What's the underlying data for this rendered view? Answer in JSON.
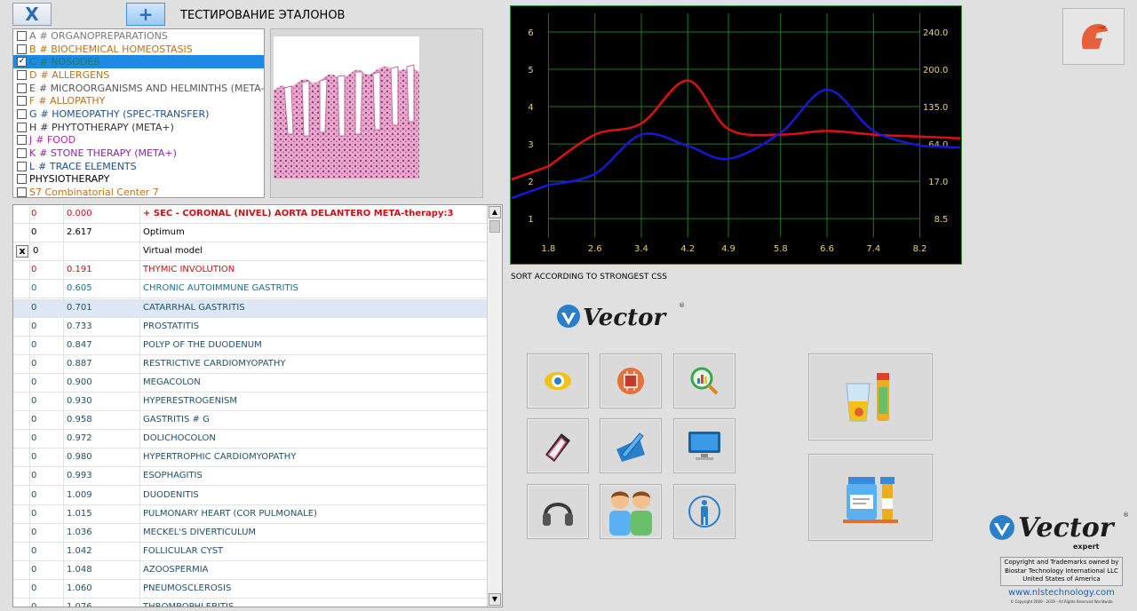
{
  "toolbar": {
    "close_label": "X",
    "add_label": "+",
    "title": "ТЕСТИРОВАНИЕ ЭТАЛОНОВ"
  },
  "categories": [
    {
      "letter": "A",
      "label": "# ORGANOPREPARATIONS",
      "color": "#7a7a7a",
      "checked": false,
      "selected": false
    },
    {
      "letter": "B",
      "label": "# BIOCHEMICAL HOMEOSTASIS",
      "color": "#c0701a",
      "checked": false,
      "selected": false
    },
    {
      "letter": "C",
      "label": "# NOSODES",
      "color": "#1b7f5a",
      "checked": true,
      "selected": true
    },
    {
      "letter": "D",
      "label": "# ALLERGENS",
      "color": "#c0701a",
      "checked": false,
      "selected": false
    },
    {
      "letter": "E",
      "label": "# MICROORGANISMS AND HELMINTHS (META-)",
      "color": "#555555",
      "checked": false,
      "selected": false
    },
    {
      "letter": "F",
      "label": "# ALLOPATHY",
      "color": "#c0701a",
      "checked": false,
      "selected": false
    },
    {
      "letter": "G",
      "label": "# HOMEOPATHY (SPEC-TRANSFER)",
      "color": "#1f4f8a",
      "checked": false,
      "selected": false
    },
    {
      "letter": "H",
      "label": "# PHYTOTHERAPY (META+)",
      "color": "#333333",
      "checked": false,
      "selected": false
    },
    {
      "letter": "J",
      "label": "# FOOD",
      "color": "#c020a8",
      "checked": false,
      "selected": false
    },
    {
      "letter": "K",
      "label": "# STONE THERAPY (META+)",
      "color": "#8a2aa0",
      "checked": false,
      "selected": false
    },
    {
      "letter": "L",
      "label": "# TRACE ELEMENTS",
      "color": "#1f4f8a",
      "checked": false,
      "selected": false
    },
    {
      "letter": "",
      "label": "PHYSIOTHERAPY",
      "color": "#000000",
      "checked": false,
      "selected": false
    },
    {
      "letter": "",
      "label": "S7 Combinatorial Center 7",
      "color": "#c0701a",
      "checked": false,
      "selected": false
    }
  ],
  "table": {
    "rows": [
      {
        "col1": "0",
        "col2": "0.000",
        "name": "+ SEC - CORONAL (NIVEL) AORTA DELANTERO META-therapy:3",
        "color": "#cc1111",
        "bold": true,
        "xbox": false,
        "highlight": false
      },
      {
        "col1": "0",
        "col2": "2.617",
        "name": "Optimum",
        "color": "#000000",
        "bold": false,
        "xbox": false,
        "highlight": false
      },
      {
        "col1": "0",
        "col2": "",
        "name": "Virtual model",
        "color": "#000000",
        "bold": false,
        "xbox": true,
        "xbox_label": "x",
        "highlight": false
      },
      {
        "col1": "0",
        "col2": "0.191",
        "name": "THYMIC INVOLUTION",
        "color": "#cc1111",
        "bold": false,
        "xbox": false,
        "highlight": false
      },
      {
        "col1": "0",
        "col2": "0.605",
        "name": "CHRONIC AUTOIMMUNE GASTRITIS",
        "color": "#1f6f8a",
        "bold": false,
        "xbox": false,
        "highlight": false
      },
      {
        "col1": "0",
        "col2": "0.701",
        "name": "CATARRHAL GASTRITIS",
        "color": "#1f4f6a",
        "bold": false,
        "xbox": false,
        "highlight": true
      },
      {
        "col1": "0",
        "col2": "0.733",
        "name": "PROSTATITIS",
        "color": "#1f4f6a",
        "bold": false,
        "xbox": false,
        "highlight": false
      },
      {
        "col1": "0",
        "col2": "0.847",
        "name": "POLYP OF THE DUODENUM",
        "color": "#1f4f6a",
        "bold": false,
        "xbox": false,
        "highlight": false
      },
      {
        "col1": "0",
        "col2": "0.887",
        "name": "RESTRICTIVE CARDIOMYOPATHY",
        "color": "#1f4f6a",
        "bold": false,
        "xbox": false,
        "highlight": false
      },
      {
        "col1": "0",
        "col2": "0.900",
        "name": "MEGACOLON",
        "color": "#1f4f6a",
        "bold": false,
        "xbox": false,
        "highlight": false
      },
      {
        "col1": "0",
        "col2": "0.930",
        "name": "HYPERESTROGENISM",
        "color": "#1f4f6a",
        "bold": false,
        "xbox": false,
        "highlight": false
      },
      {
        "col1": "0",
        "col2": "0.958",
        "name": "GASTRITIS # G",
        "color": "#1f4f6a",
        "bold": false,
        "xbox": false,
        "highlight": false
      },
      {
        "col1": "0",
        "col2": "0.972",
        "name": "DOLICHOCOLON",
        "color": "#1f4f6a",
        "bold": false,
        "xbox": false,
        "highlight": false
      },
      {
        "col1": "0",
        "col2": "0.980",
        "name": "HYPERTROPHIC CARDIOMYOPATHY",
        "color": "#1f4f6a",
        "bold": false,
        "xbox": false,
        "highlight": false
      },
      {
        "col1": "0",
        "col2": "0.993",
        "name": "ESOPHAGITIS",
        "color": "#1f4f6a",
        "bold": false,
        "xbox": false,
        "highlight": false
      },
      {
        "col1": "0",
        "col2": "1.009",
        "name": "DUODENITIS",
        "color": "#1f4f6a",
        "bold": false,
        "xbox": false,
        "highlight": false
      },
      {
        "col1": "0",
        "col2": "1.015",
        "name": "PULMONARY HEART (COR PULMONALE)",
        "color": "#1f4f6a",
        "bold": false,
        "xbox": false,
        "highlight": false
      },
      {
        "col1": "0",
        "col2": "1.036",
        "name": "MECKEL'S DIVERTICULUM",
        "color": "#1f4f6a",
        "bold": false,
        "xbox": false,
        "highlight": false
      },
      {
        "col1": "0",
        "col2": "1.042",
        "name": "FOLLICULAR CYST",
        "color": "#1f4f6a",
        "bold": false,
        "xbox": false,
        "highlight": false
      },
      {
        "col1": "0",
        "col2": "1.048",
        "name": "AZOOSPERMIA",
        "color": "#1f4f6a",
        "bold": false,
        "xbox": false,
        "highlight": false
      },
      {
        "col1": "0",
        "col2": "1.060",
        "name": "PNEUMOSCLEROSIS",
        "color": "#1f4f6a",
        "bold": false,
        "xbox": false,
        "highlight": false
      },
      {
        "col1": "0",
        "col2": "1.076",
        "name": "THROMBOPHLEBITIS",
        "color": "#1f4f6a",
        "bold": false,
        "xbox": false,
        "highlight": false
      }
    ]
  },
  "chart_data": {
    "type": "line",
    "x_ticks": [
      "1.8",
      "2.6",
      "3.4",
      "4.2",
      "4.9",
      "5.8",
      "6.6",
      "7.4",
      "8.2"
    ],
    "y_left_ticks": [
      "6",
      "5",
      "4",
      "3",
      "2",
      "1"
    ],
    "y_right_ticks": [
      "240.0",
      "200.0",
      "135.0",
      "64.0",
      "17.0",
      "8.5"
    ],
    "ylim": [
      0.5,
      6.5
    ],
    "xlim": [
      1.8,
      8.2
    ],
    "series": [
      {
        "color": "#e01010",
        "x": [
          1.8,
          2.6,
          3.4,
          4.2,
          4.9,
          5.8,
          6.6,
          7.4,
          8.2
        ],
        "y": [
          2.4,
          3.25,
          3.55,
          4.7,
          3.4,
          3.25,
          3.35,
          3.25,
          3.2
        ]
      },
      {
        "color": "#1818d8",
        "x": [
          1.8,
          2.6,
          3.4,
          4.2,
          4.9,
          5.8,
          6.6,
          7.4,
          8.2
        ],
        "y": [
          1.9,
          2.2,
          3.25,
          2.95,
          2.6,
          3.3,
          4.45,
          3.35,
          2.95
        ]
      }
    ],
    "grid_color": "#1f7a1f",
    "axis_label_color": "#e8d070",
    "grid": true
  },
  "sort_label": "SORT ACCORDING TO STRONGEST CSS",
  "brand": {
    "logo_text": "Vector",
    "expert_text": "expert",
    "trademark": "®"
  },
  "tools": [
    {
      "name": "eye-scan-button",
      "icon": "eye-icon"
    },
    {
      "name": "chip-button",
      "icon": "chip-icon"
    },
    {
      "name": "analysis-search-button",
      "icon": "magnifier-chart-icon"
    },
    {
      "name": "book-button",
      "icon": "book-icon"
    },
    {
      "name": "pen-tablet-button",
      "icon": "pen-icon"
    },
    {
      "name": "monitor-button",
      "icon": "monitor-icon"
    },
    {
      "name": "headphones-button",
      "icon": "headphones-icon"
    },
    {
      "name": "people-button",
      "icon": "people-icon"
    },
    {
      "name": "body-button",
      "icon": "body-icon"
    }
  ],
  "big_tools": [
    {
      "name": "remedy-glass-button",
      "icon": "glass-tube-icon"
    },
    {
      "name": "remedy-bottles-button",
      "icon": "bottles-icon"
    }
  ],
  "footer": {
    "copyright_line1": "Copyright and Trademarks owned by",
    "copyright_line2": "Biostar Technology International LLC",
    "copyright_line3": "United States of America",
    "website": "www.nlstechnology.com",
    "rights": "© Copyright 2009 - 2019 - All Rights Reserved Worldwide"
  },
  "colors": {
    "accent": "#1e88e5",
    "chart_bg": "#000000",
    "panel": "#e0e0e0"
  }
}
